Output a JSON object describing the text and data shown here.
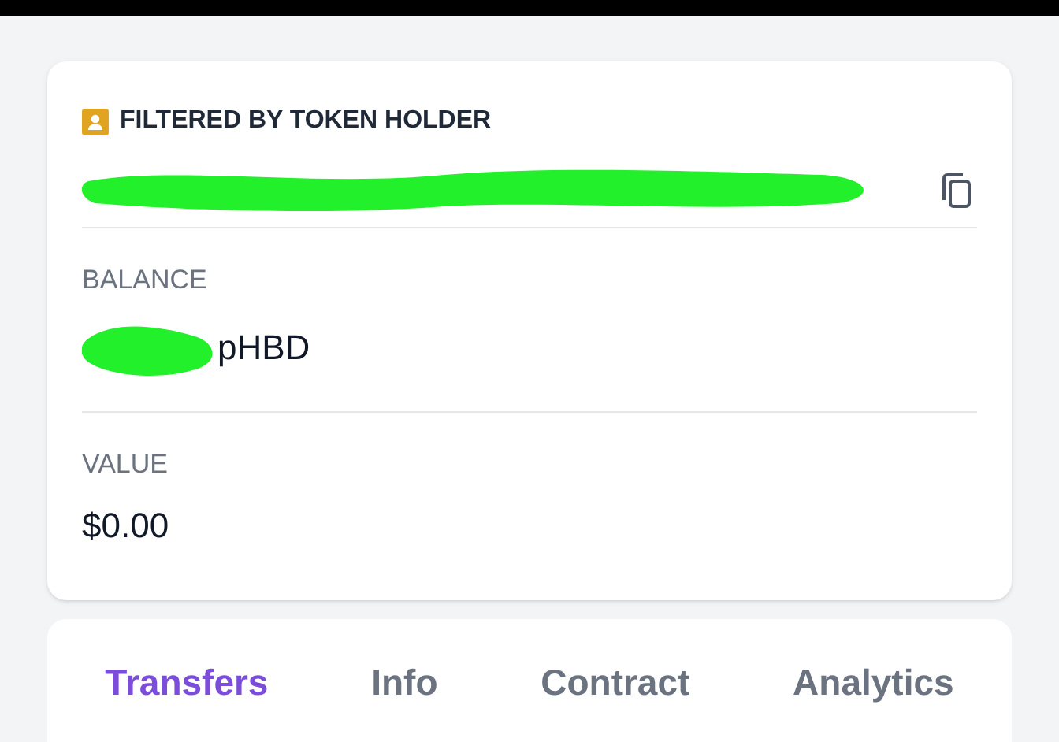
{
  "holder_card": {
    "filter_label": "FILTERED BY TOKEN HOLDER",
    "fields": [
      {
        "label": "BALANCE",
        "value": "pHBD"
      },
      {
        "label": "VALUE",
        "value": "$0.00"
      }
    ]
  },
  "tabs": [
    {
      "label": "Transfers",
      "selected": true
    },
    {
      "label": "Info",
      "selected": false
    },
    {
      "label": "Contract",
      "selected": false
    },
    {
      "label": "Analytics",
      "selected": false
    }
  ]
}
